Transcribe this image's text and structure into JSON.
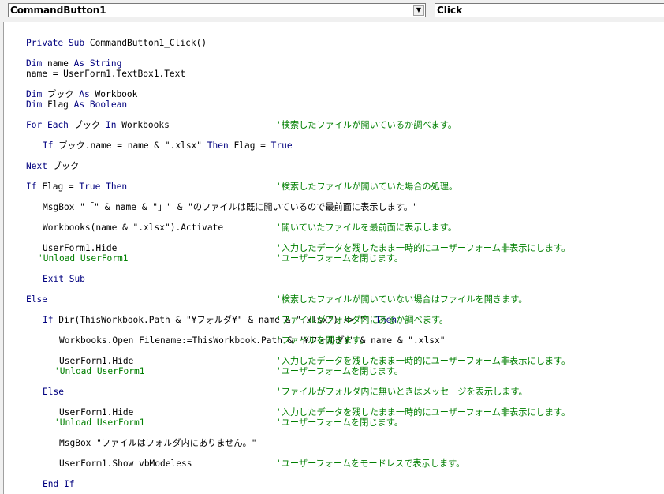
{
  "header": {
    "object_combo": "CommandButton1",
    "procedure_combo": "Click"
  },
  "colors": {
    "keyword": "#00007f",
    "text": "#000000",
    "comment": "#007f00"
  },
  "code": [
    {
      "indent": 0,
      "code": "Private Sub CommandButton1_Click()",
      "comment": ""
    },
    {
      "indent": 0,
      "code": "Dim name As String",
      "comment": ""
    },
    {
      "indent": 0,
      "code": "name = UserForm1.TextBox1.Text",
      "comment": ""
    },
    {
      "indent": 0,
      "code": "Dim ブック As Workbook",
      "comment": ""
    },
    {
      "indent": 0,
      "code": "Dim Flag As Boolean",
      "comment": ""
    },
    {
      "indent": 0,
      "code": "For Each ブック In Workbooks",
      "comment": "'検索したファイルが開いているか調べます。"
    },
    {
      "indent": 1,
      "code": "If ブック.name = name & \".xlsx\" Then Flag = True",
      "comment": ""
    },
    {
      "indent": 0,
      "code": "Next ブック",
      "comment": ""
    },
    {
      "indent": 0,
      "code": "If Flag = True Then",
      "comment": "'検索したファイルが開いていた場合の処理。"
    },
    {
      "indent": 1,
      "code": "MsgBox \"「\" & name & \"」\" & \"のファイルは既に開いているので最前面に表示します。\"",
      "comment": ""
    },
    {
      "indent": 1,
      "code": "Workbooks(name & \".xlsx\").Activate",
      "comment": "'開いていたファイルを最前面に表示します。"
    },
    {
      "indent": 1,
      "code": "UserForm1.Hide",
      "comment": "'入力したデータを残したまま一時的にユーザーフォーム非表示にします。"
    },
    {
      "indent": 1,
      "code": "",
      "comment": "'Unload UserForm1",
      "comment_offset": -1
    },
    {
      "indent": 1,
      "code": "Exit Sub",
      "comment": ""
    },
    {
      "indent": 0,
      "code": "Else",
      "comment": "'検索したファイルが開いていない場合はファイルを開きます。"
    },
    {
      "indent": 1,
      "code": "If Dir(ThisWorkbook.Path & \"¥フォルダ¥\" & name & \".xlsx\") <> \"\" Then",
      "comment": "'ファイルがフォルダ内にあるか調べます。"
    },
    {
      "indent": 2,
      "code": "Workbooks.Open Filename:=ThisWorkbook.Path & \"¥フォルダ¥\" & name & \".xlsx\"",
      "comment": "'ファイルを開きます。"
    },
    {
      "indent": 2,
      "code": "UserForm1.Hide",
      "comment": "'入力したデータを残したまま一時的にユーザーフォーム非表示にします。"
    },
    {
      "indent": 2,
      "code": "",
      "comment": "'Unload UserForm1",
      "comment_offset": -1
    },
    {
      "indent": 1,
      "code": "Else",
      "comment": "'ファイルがフォルダ内に無いときはメッセージを表示します。"
    },
    {
      "indent": 2,
      "code": "UserForm1.Hide",
      "comment": "'入力したデータを残したまま一時的にユーザーフォーム非表示にします。"
    },
    {
      "indent": 2,
      "code": "",
      "comment": "'Unload UserForm1",
      "comment_offset": -1
    },
    {
      "indent": 2,
      "code": "MsgBox \"ファイルはフォルダ内にありません。\"",
      "comment": ""
    },
    {
      "indent": 2,
      "code": "UserForm1.Show vbModeless",
      "comment": "'ユーザーフォームをモードレスで表示します。"
    },
    {
      "indent": 1,
      "code": "End If",
      "comment": ""
    }
  ],
  "trailing_comments": {
    "unload_1": "'ユーザーフォームを閉じます。",
    "unload_2": "'ユーザーフォームを閉じます。",
    "unload_3": "'ユーザーフォームを閉じます。"
  }
}
